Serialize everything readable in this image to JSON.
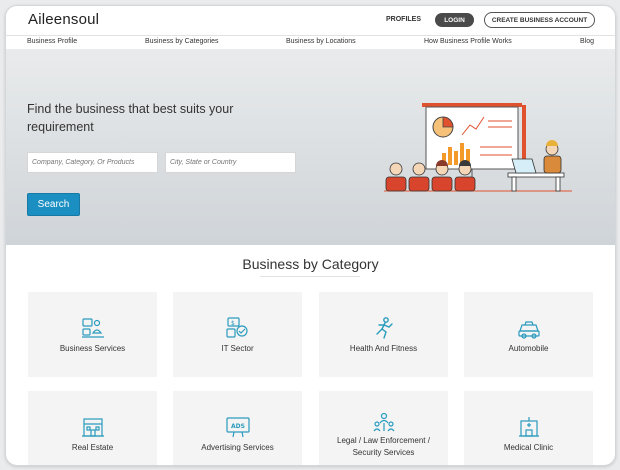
{
  "header": {
    "logo": "Aileensoul",
    "profiles": "PROFILES",
    "login": "LOGIN",
    "create": "CREATE BUSINESS ACCOUNT"
  },
  "menu": [
    "Business Profile",
    "Business by Categories",
    "Business by Locations",
    "How Business Profile Works",
    "Blog"
  ],
  "hero": {
    "title": "Find the business that best suits your requirement",
    "search_placeholder": "Company, Category, Or Products",
    "location_placeholder": "City, State or Country",
    "search_button": "Search",
    "illustration_icon": "presentation-meeting-illustration"
  },
  "section": {
    "title": "Business by Category"
  },
  "categories": [
    {
      "label": "Business Services",
      "icon": "business-services-icon"
    },
    {
      "label": "IT Sector",
      "icon": "it-sector-icon"
    },
    {
      "label": "Health And Fitness",
      "icon": "running-person-icon"
    },
    {
      "label": "Automobile",
      "icon": "car-icon"
    },
    {
      "label": "Real Estate",
      "icon": "buildings-icon"
    },
    {
      "label": "Advertising Services",
      "icon": "ads-billboard-icon"
    },
    {
      "label": "Legal / Law Enforcement / Security Services",
      "icon": "legal-security-icon"
    },
    {
      "label": "Medical Clinic",
      "icon": "clinic-icon"
    }
  ],
  "colors": {
    "accent": "#1b8fc2",
    "icon": "#2a9bbd",
    "card": "#f4f4f4"
  }
}
